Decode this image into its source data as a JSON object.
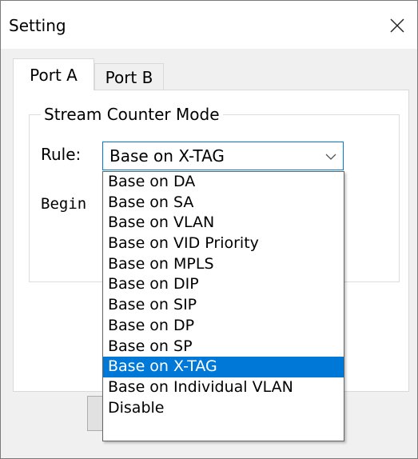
{
  "window": {
    "title": "Setting"
  },
  "tabs": [
    {
      "label": "Port A"
    },
    {
      "label": "Port B"
    }
  ],
  "group": {
    "label": "Stream Counter Mode"
  },
  "rule": {
    "label": "Rule:",
    "selected": "Base on X-TAG",
    "options": [
      "Base on DA",
      "Base on SA",
      "Base on VLAN",
      "Base on VID Priority",
      "Base on MPLS",
      "Base on DIP",
      "Base on SIP",
      "Base on DP",
      "Base on SP",
      "Base on X-TAG",
      "Base on Individual VLAN",
      "Disable"
    ]
  },
  "partial_text": "Begin",
  "colors": {
    "accent": "#0078d7",
    "panel": "#ffffff",
    "dialog_bg": "#f0f0f0"
  }
}
